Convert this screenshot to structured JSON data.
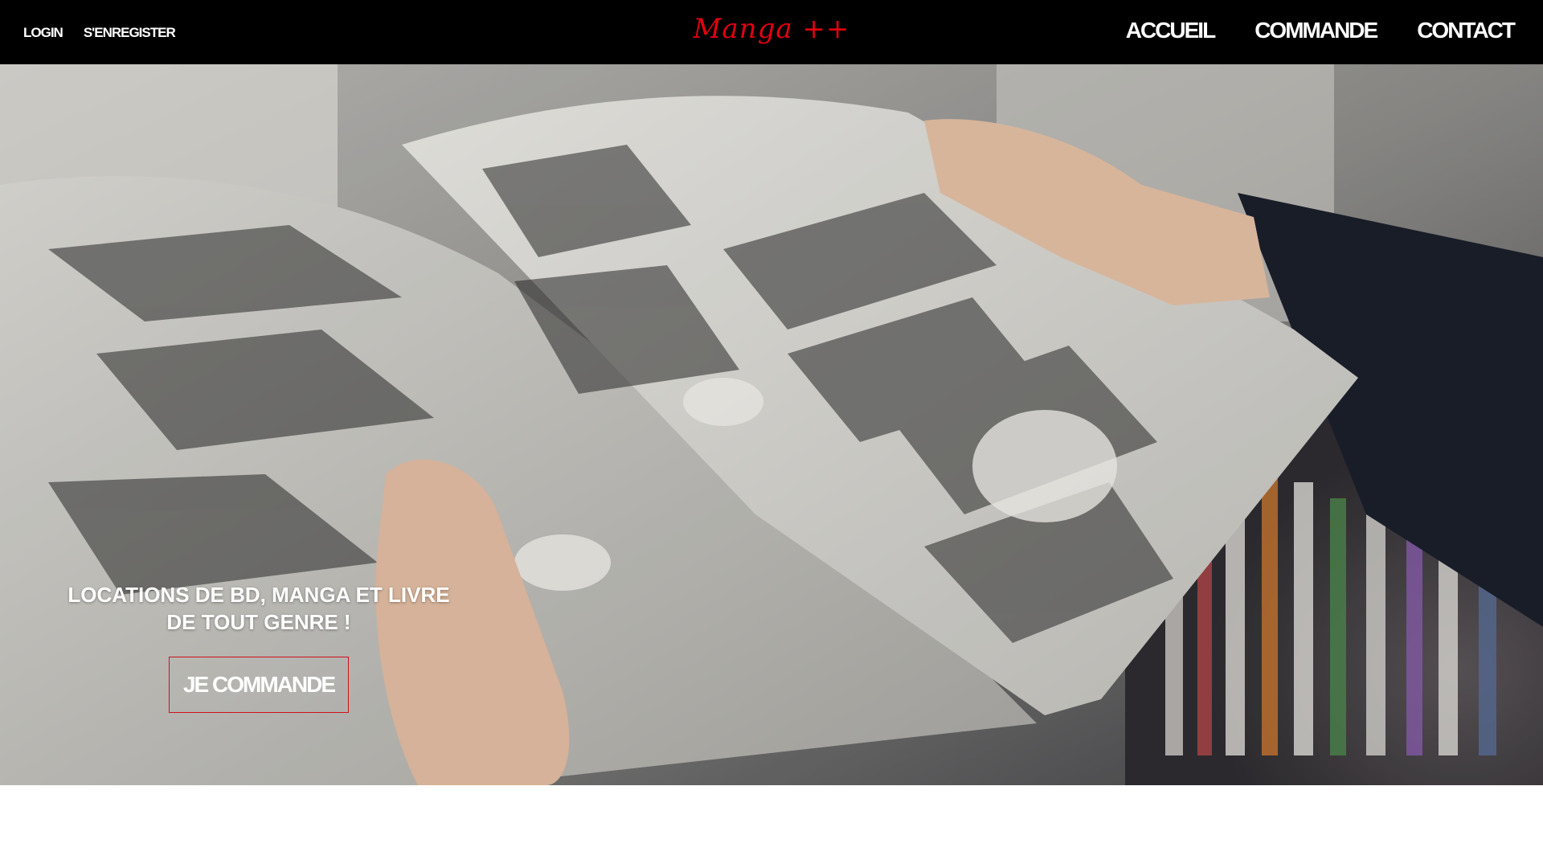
{
  "header": {
    "auth": {
      "login_label": "LOGIN",
      "register_label": "S'ENREGISTER"
    },
    "brand": "Manga ++",
    "nav": {
      "home_label": "ACCUEIL",
      "order_label": "COMMANDE",
      "contact_label": "CONTACT"
    }
  },
  "hero": {
    "title": "LOCATIONS DE BD, MANGA ET LIVRE\nDE  TOUT  GENRE !",
    "cta_label": "JE COMMANDE",
    "image_subject": "hands holding an open black-and-white manga in a bookstore"
  },
  "colors": {
    "navbar_bg": "#000000",
    "brand": "#e3000f",
    "cta_border": "#d0101c",
    "nav_text": "#ffffff"
  }
}
